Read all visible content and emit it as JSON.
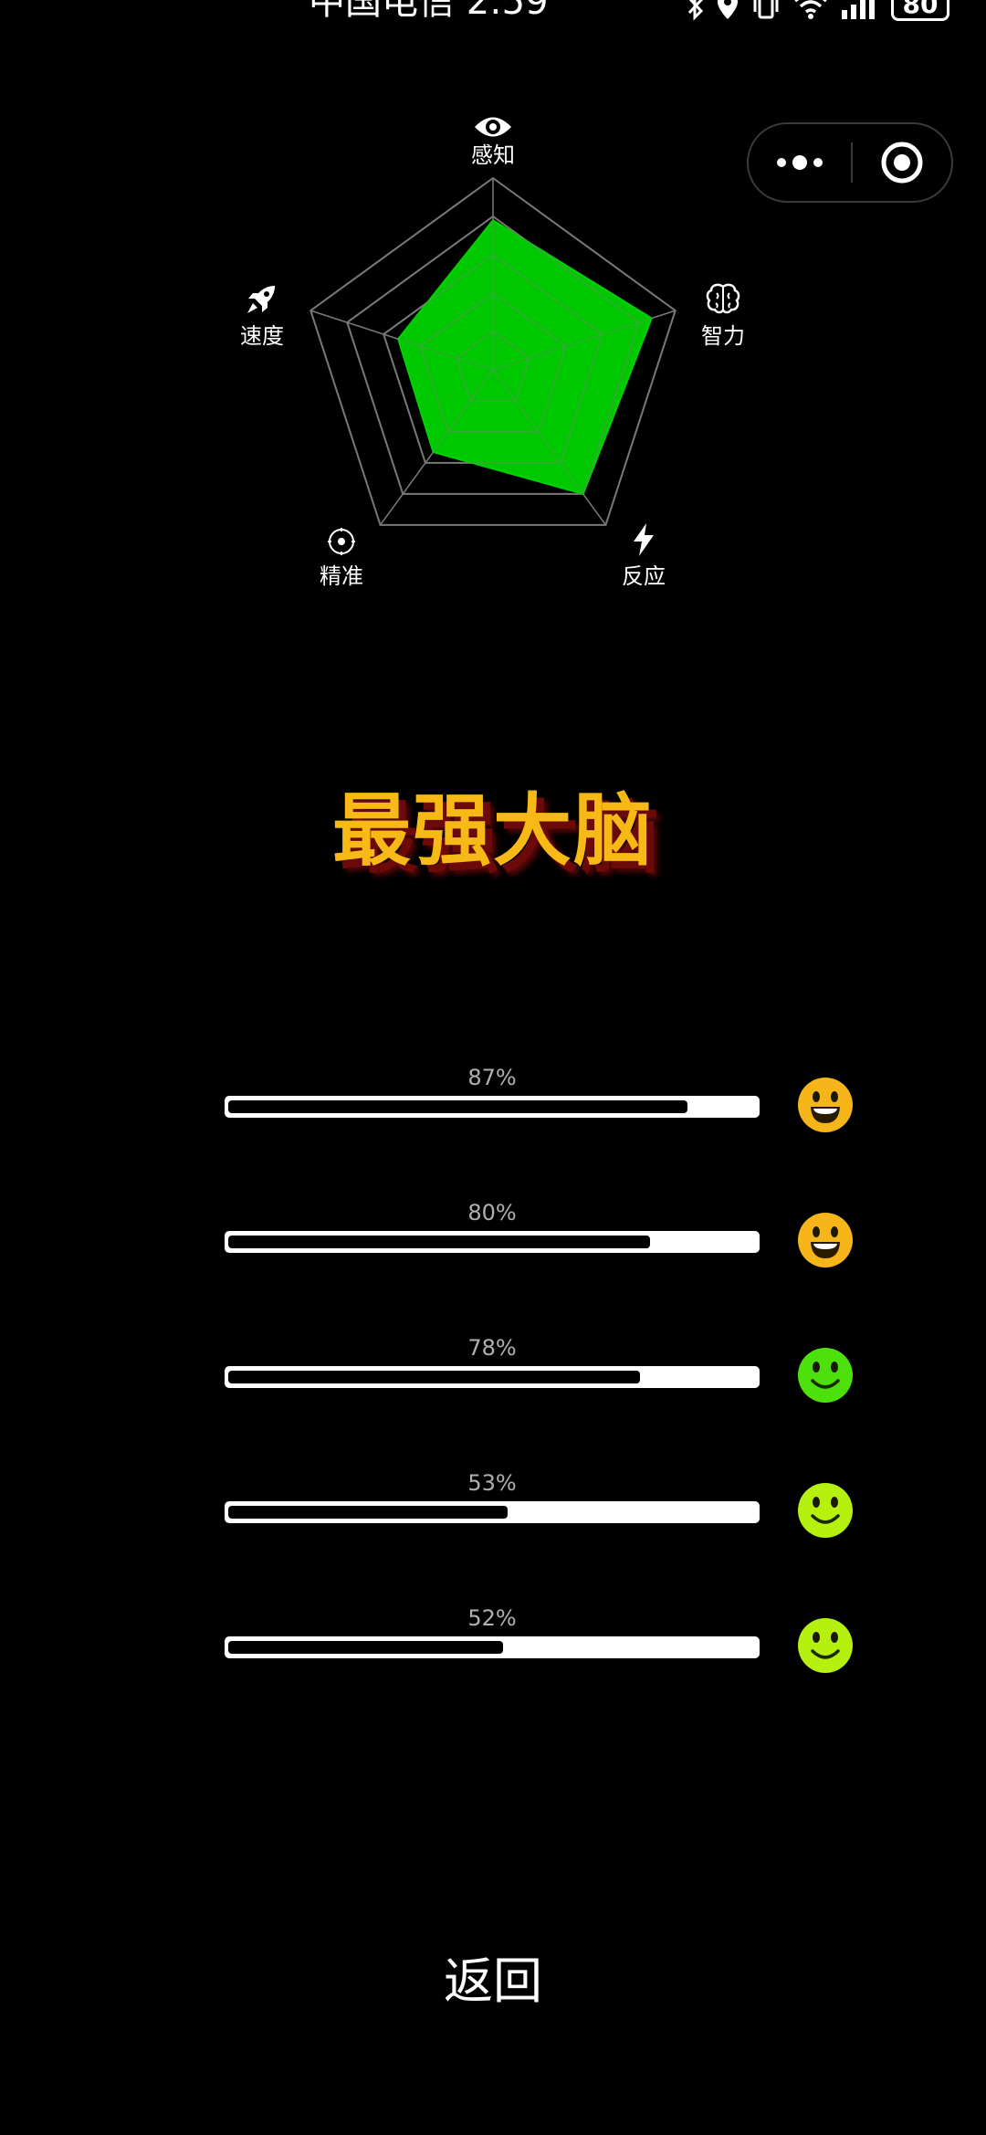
{
  "status_bar": {
    "carrier_time": "中国电信 2:59",
    "battery": "80",
    "icons": [
      "bluetooth-icon",
      "location-icon",
      "vibrate-icon",
      "wifi-icon",
      "signal-icon",
      "battery-icon"
    ]
  },
  "capsule": {
    "more_icon": "more-dots-icon",
    "close_icon": "target-close-icon"
  },
  "radar": {
    "axes": [
      {
        "label": "感知",
        "icon": "eye-icon",
        "value": 0.78
      },
      {
        "label": "智力",
        "icon": "brain-icon",
        "value": 0.87
      },
      {
        "label": "反应",
        "icon": "lightning-icon",
        "value": 0.8
      },
      {
        "label": "精准",
        "icon": "target-icon",
        "value": 0.53
      },
      {
        "label": "速度",
        "icon": "rocket-icon",
        "value": 0.52
      }
    ],
    "fill_color": "#00d300",
    "grid_color": "#777777"
  },
  "title": "最强大脑",
  "colors": {
    "title": "#f7b915",
    "title_shadow": "#6b0a08",
    "face_yellow": "#f6b61a",
    "face_green": "#4ee00a",
    "face_lime": "#b5f00e"
  },
  "progress": [
    {
      "percent_label": "87%",
      "value": 0.87,
      "face": "grinning-face-icon",
      "face_color": "#f6b61a"
    },
    {
      "percent_label": "80%",
      "value": 0.8,
      "face": "grinning-face-icon",
      "face_color": "#f6b61a"
    },
    {
      "percent_label": "78%",
      "value": 0.78,
      "face": "smiling-face-icon",
      "face_color": "#4ee00a"
    },
    {
      "percent_label": "53%",
      "value": 0.53,
      "face": "smiling-face-icon",
      "face_color": "#b5f00e"
    },
    {
      "percent_label": "52%",
      "value": 0.52,
      "face": "smiling-face-icon",
      "face_color": "#b5f00e"
    }
  ],
  "back_button": "返回"
}
